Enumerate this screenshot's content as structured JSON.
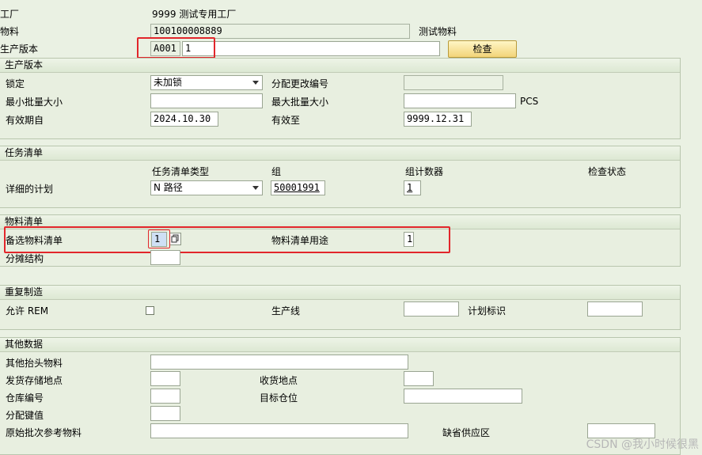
{
  "header": {
    "plant_label": "工厂",
    "plant_value": "9999 测试专用工厂",
    "material_label": "物料",
    "material_value": "100100008889",
    "material_desc": "测试物料",
    "prodver_label": "生产版本",
    "prodver_code": "A001",
    "prodver_num": "1",
    "check_button": "检查"
  },
  "prod_version": {
    "title": "生产版本",
    "lock_label": "锁定",
    "lock_value": "未加锁",
    "change_no_label": "分配更改编号",
    "min_lot_label": "最小批量大小",
    "max_lot_label": "最大批量大小",
    "unit": "PCS",
    "valid_from_label": "有效期自",
    "valid_from_value": "2024.10.30",
    "valid_to_label": "有效至",
    "valid_to_value": "9999.12.31"
  },
  "routing": {
    "title": "任务清单",
    "col_type": "任务清单类型",
    "col_group": "组",
    "col_counter": "组计数器",
    "col_status": "检查状态",
    "row_label": "详细的计划",
    "type_value": "N 路径",
    "group_value": "50001991",
    "counter_value": "1"
  },
  "bom": {
    "title": "物料清单",
    "alt_bom_label": "备选物料清单",
    "alt_bom_value": "1",
    "usage_label": "物料清单用途",
    "usage_value": "1",
    "apportion_label": "分摊结构"
  },
  "rem": {
    "title": "重复制造",
    "allow_label": "允许 REM",
    "line_label": "生产线",
    "plan_id_label": "计划标识"
  },
  "other": {
    "title": "其他数据",
    "other_header_label": "其他抬头物料",
    "issue_loc_label": "发货存储地点",
    "receive_loc_label": "收货地点",
    "warehouse_label": "仓库编号",
    "dest_bin_label": "目标仓位",
    "dist_key_label": "分配键值",
    "orig_batch_label": "原始批次参考物料",
    "default_area_label": "缺省供应区"
  },
  "watermark": "CSDN @我小时候很黑"
}
